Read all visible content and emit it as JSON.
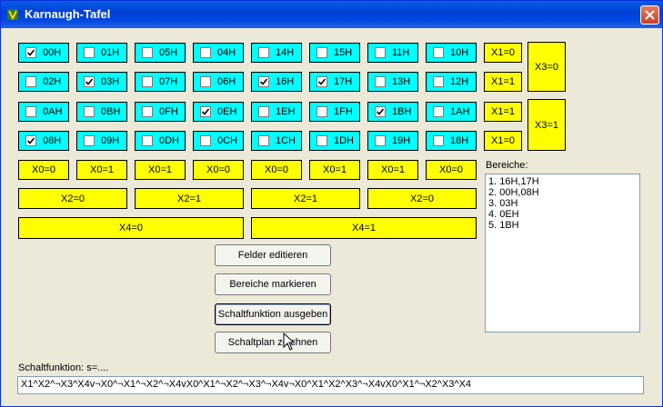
{
  "window": {
    "title": "Karnaugh-Tafel"
  },
  "grid": [
    [
      {
        "label": "00H",
        "checked": true
      },
      {
        "label": "01H",
        "checked": false
      },
      {
        "label": "05H",
        "checked": false
      },
      {
        "label": "04H",
        "checked": false
      },
      {
        "label": "14H",
        "checked": false
      },
      {
        "label": "15H",
        "checked": false
      },
      {
        "label": "11H",
        "checked": false
      },
      {
        "label": "10H",
        "checked": false
      }
    ],
    [
      {
        "label": "02H",
        "checked": false
      },
      {
        "label": "03H",
        "checked": true
      },
      {
        "label": "07H",
        "checked": false
      },
      {
        "label": "06H",
        "checked": false
      },
      {
        "label": "16H",
        "checked": true
      },
      {
        "label": "17H",
        "checked": true
      },
      {
        "label": "13H",
        "checked": false
      },
      {
        "label": "12H",
        "checked": false
      }
    ],
    [
      {
        "label": "0AH",
        "checked": false
      },
      {
        "label": "0BH",
        "checked": false
      },
      {
        "label": "0FH",
        "checked": false
      },
      {
        "label": "0EH",
        "checked": true
      },
      {
        "label": "1EH",
        "checked": false
      },
      {
        "label": "1FH",
        "checked": false
      },
      {
        "label": "1BH",
        "checked": true
      },
      {
        "label": "1AH",
        "checked": false
      }
    ],
    [
      {
        "label": "08H",
        "checked": true
      },
      {
        "label": "09H",
        "checked": false
      },
      {
        "label": "0DH",
        "checked": false
      },
      {
        "label": "0CH",
        "checked": false
      },
      {
        "label": "1CH",
        "checked": false
      },
      {
        "label": "1DH",
        "checked": false
      },
      {
        "label": "19H",
        "checked": false
      },
      {
        "label": "18H",
        "checked": false
      }
    ]
  ],
  "x1_labels": [
    "X1=0",
    "X1=1",
    "X1=1",
    "X1=0"
  ],
  "x3_labels": [
    "X3=0",
    "X3=1"
  ],
  "x0_labels": [
    "X0=0",
    "X0=1",
    "X0=1",
    "X0=0",
    "X0=0",
    "X0=1",
    "X0=1",
    "X0=0"
  ],
  "x2_labels": [
    "X2=0",
    "X2=1",
    "X2=1",
    "X2=0"
  ],
  "x4_labels": [
    "X4=0",
    "X4=1"
  ],
  "buttons": {
    "edit": "Felder editieren",
    "mark": "Bereiche markieren",
    "output": "Schaltfunktion ausgeben",
    "draw": "Schaltplan zeichnen"
  },
  "bereiche": {
    "label": "Bereiche:",
    "items": [
      "1. 16H,17H",
      "2. 00H,08H",
      "3. 03H",
      "4. 0EH",
      "5. 1BH"
    ]
  },
  "schaltfunktion": {
    "label": "Schaltfunktion: s=....",
    "value": "X1^X2^¬X3^X4v¬X0^¬X1^¬X2^¬X4vX0^X1^¬X2^¬X3^¬X4v¬X0^X1^X2^X3^¬X4vX0^X1^¬X2^X3^X4"
  },
  "colors": {
    "cell": "#00ffff",
    "label_cell": "#ffff00",
    "titlebar": "#0a5ce8"
  }
}
